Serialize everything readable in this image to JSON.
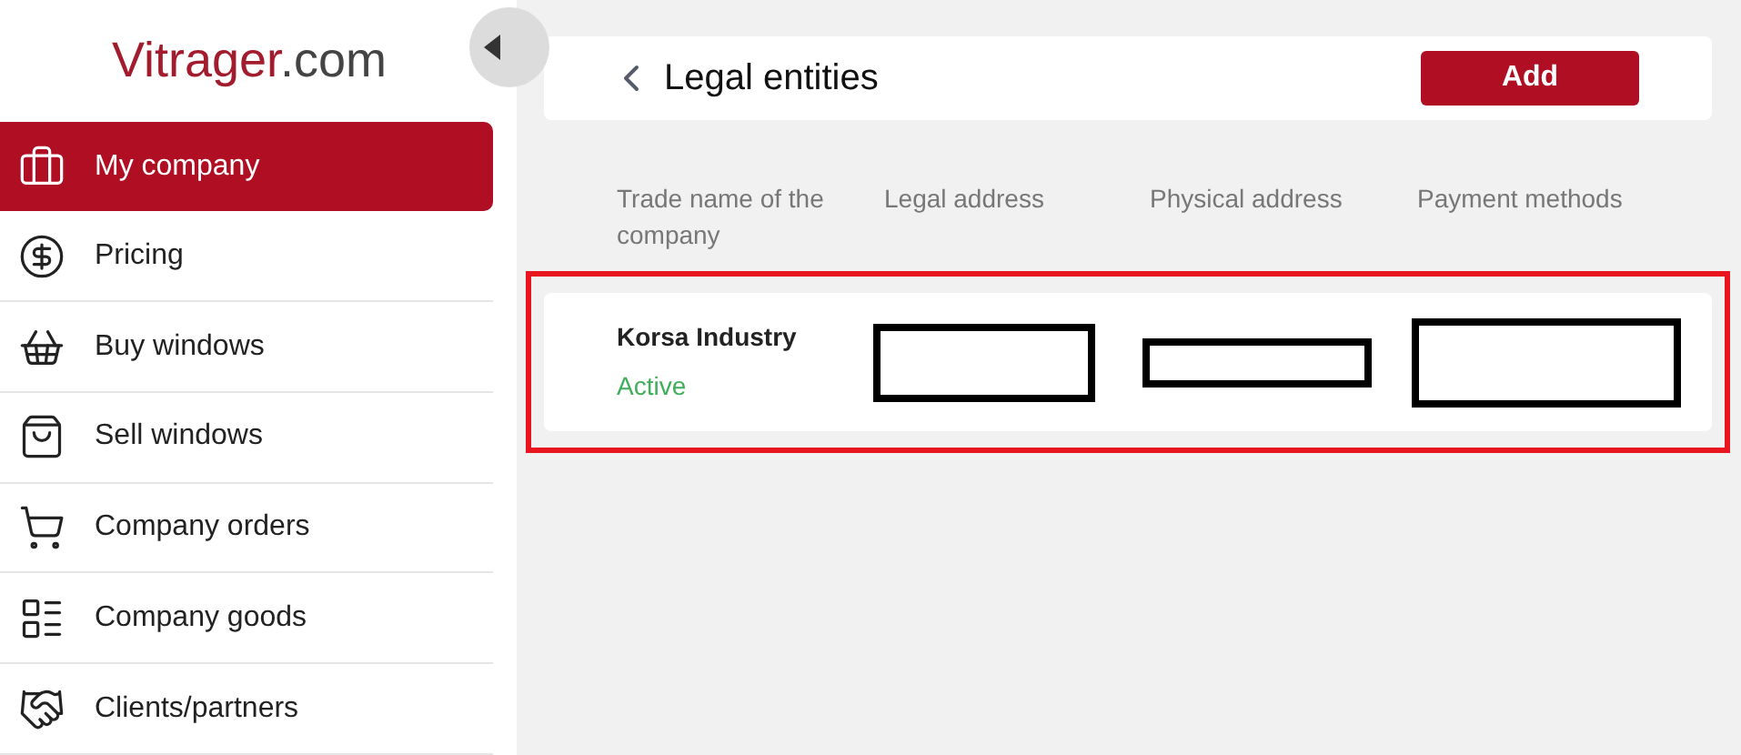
{
  "logo": {
    "brand": "Vitrager",
    "suffix": ".com"
  },
  "sidebar": {
    "items": [
      {
        "label": "My company",
        "selected": true
      },
      {
        "label": "Pricing",
        "selected": false
      },
      {
        "label": "Buy windows",
        "selected": false
      },
      {
        "label": "Sell windows",
        "selected": false
      },
      {
        "label": "Company orders",
        "selected": false
      },
      {
        "label": "Company goods",
        "selected": false
      },
      {
        "label": "Clients/partners",
        "selected": false
      }
    ]
  },
  "header": {
    "title": "Legal entities",
    "button": "Add"
  },
  "table": {
    "columns": [
      "Trade name of the company",
      "Legal address",
      "Physical address",
      "Payment methods"
    ],
    "rows": [
      {
        "name": "Korsa Industry",
        "status": "Active",
        "highlighted": true,
        "cells": [
          {
            "kind": "redacted"
          },
          {
            "kind": "redacted"
          },
          {
            "kind": "redacted"
          }
        ]
      }
    ]
  }
}
